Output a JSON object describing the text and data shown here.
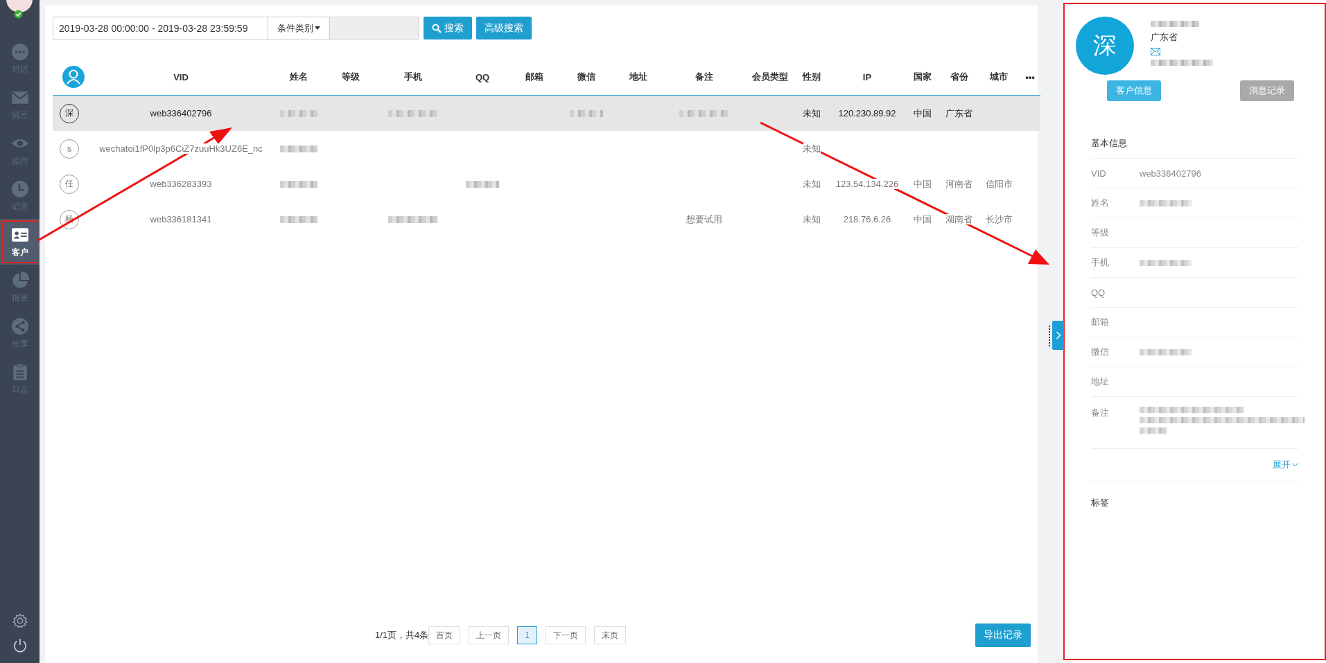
{
  "sidebar": {
    "items": [
      {
        "label": "对话",
        "selected": false
      },
      {
        "label": "留言",
        "selected": false
      },
      {
        "label": "监控",
        "selected": false
      },
      {
        "label": "记录",
        "selected": false
      },
      {
        "label": "客户",
        "selected": true
      },
      {
        "label": "报表",
        "selected": false
      },
      {
        "label": "分享",
        "selected": false
      },
      {
        "label": "日志",
        "selected": false
      }
    ]
  },
  "search": {
    "date_range": "2019-03-28 00:00:00 - 2019-03-28 23:59:59",
    "category": "条件类别",
    "buttons": [
      "搜索",
      "高级搜索"
    ]
  },
  "table": {
    "columns": [
      "VID",
      "姓名",
      "等级",
      "手机",
      "QQ",
      "邮箱",
      "微信",
      "地址",
      "备注",
      "会员类型",
      "性别",
      "IP",
      "国家",
      "省份",
      "城市"
    ],
    "more": "•••",
    "rows": [
      {
        "avatar": "深",
        "selected": true,
        "cells": [
          {
            "kind": "text",
            "text": "web336402796"
          },
          {
            "kind": "blurred"
          },
          {
            "kind": "empty"
          },
          {
            "kind": "blurred"
          },
          {
            "kind": "empty"
          },
          {
            "kind": "empty"
          },
          {
            "kind": "blurred"
          },
          {
            "kind": "empty"
          },
          {
            "kind": "blurred"
          },
          {
            "kind": "empty"
          },
          {
            "kind": "text",
            "text": "未知"
          },
          {
            "kind": "text",
            "text": "120.230.89.92"
          },
          {
            "kind": "text",
            "text": "中国"
          },
          {
            "kind": "text",
            "text": "广东省"
          },
          {
            "kind": "empty"
          }
        ]
      },
      {
        "avatar": "s",
        "selected": false,
        "cells": [
          {
            "kind": "text",
            "text": "wechatoi1fP0lp3p6CiZ7zuuHk3UZ6E_nc"
          },
          {
            "kind": "blurred"
          },
          {
            "kind": "empty"
          },
          {
            "kind": "empty"
          },
          {
            "kind": "empty"
          },
          {
            "kind": "empty"
          },
          {
            "kind": "empty"
          },
          {
            "kind": "empty"
          },
          {
            "kind": "empty"
          },
          {
            "kind": "empty"
          },
          {
            "kind": "text",
            "text": "未知"
          },
          {
            "kind": "empty"
          },
          {
            "kind": "empty"
          },
          {
            "kind": "empty"
          },
          {
            "kind": "empty"
          }
        ]
      },
      {
        "avatar": "任",
        "selected": false,
        "cells": [
          {
            "kind": "text",
            "text": "web336283393"
          },
          {
            "kind": "blurred"
          },
          {
            "kind": "empty"
          },
          {
            "kind": "empty"
          },
          {
            "kind": "blurred"
          },
          {
            "kind": "empty"
          },
          {
            "kind": "empty"
          },
          {
            "kind": "empty"
          },
          {
            "kind": "empty"
          },
          {
            "kind": "empty"
          },
          {
            "kind": "text",
            "text": "未知"
          },
          {
            "kind": "text",
            "text": "123.54.134.226"
          },
          {
            "kind": "text",
            "text": "中国"
          },
          {
            "kind": "text",
            "text": "河南省"
          },
          {
            "kind": "text",
            "text": "信阳市"
          }
        ]
      },
      {
        "avatar": "杨",
        "selected": false,
        "cells": [
          {
            "kind": "text",
            "text": "web336181341"
          },
          {
            "kind": "blurred"
          },
          {
            "kind": "empty"
          },
          {
            "kind": "blurred"
          },
          {
            "kind": "empty"
          },
          {
            "kind": "empty"
          },
          {
            "kind": "empty"
          },
          {
            "kind": "empty"
          },
          {
            "kind": "text",
            "text": "想要试用"
          },
          {
            "kind": "empty"
          },
          {
            "kind": "text",
            "text": "未知"
          },
          {
            "kind": "text",
            "text": "218.76.6.26"
          },
          {
            "kind": "text",
            "text": "中国"
          },
          {
            "kind": "text",
            "text": "湖南省"
          },
          {
            "kind": "text",
            "text": "长沙市"
          }
        ]
      }
    ]
  },
  "pagination": {
    "summary": "1/1页，共4条",
    "pages": [
      {
        "label": "首页",
        "selected": false
      },
      {
        "label": "上一页",
        "selected": false
      },
      {
        "label": "1",
        "selected": true
      },
      {
        "label": "下一页",
        "selected": false
      },
      {
        "label": "末页",
        "selected": false
      }
    ]
  },
  "export_button": "导出记录",
  "detail": {
    "avatar": "深",
    "province": "广东省",
    "tabs": [
      {
        "label": "客户信息",
        "selected": true
      },
      {
        "label": "消息记录",
        "selected": false
      }
    ],
    "section": "基本信息",
    "fields": [
      {
        "label": "VID",
        "kind": "text",
        "value": "web336402796"
      },
      {
        "label": "姓名",
        "kind": "blurred"
      },
      {
        "label": "等级",
        "kind": "empty"
      },
      {
        "label": "手机",
        "kind": "blurred"
      },
      {
        "label": "QQ",
        "kind": "empty"
      },
      {
        "label": "邮箱",
        "kind": "empty"
      },
      {
        "label": "微信",
        "kind": "blurred"
      },
      {
        "label": "地址",
        "kind": "empty"
      },
      {
        "label": "备注",
        "kind": "blurred_area"
      }
    ],
    "expand": "展开",
    "tags_label": "标签"
  }
}
